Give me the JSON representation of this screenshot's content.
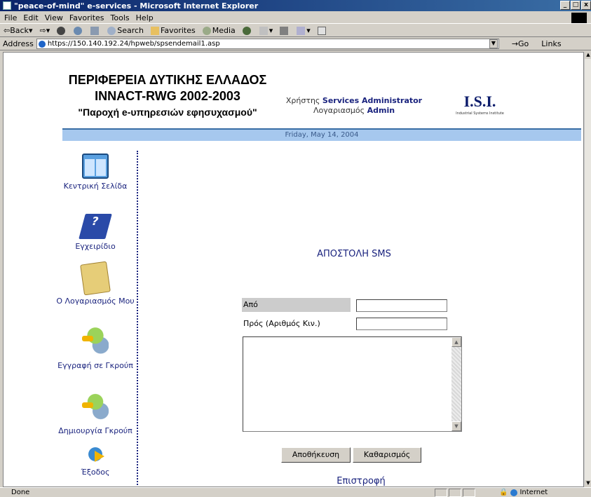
{
  "window": {
    "title": "\"peace-of-mind\" e-services - Microsoft Internet Explorer"
  },
  "menu": [
    "File",
    "Edit",
    "View",
    "Favorites",
    "Tools",
    "Help"
  ],
  "toolbar": {
    "back": "Back",
    "search": "Search",
    "favorites": "Favorites",
    "media": "Media"
  },
  "address": {
    "label": "Address",
    "url": "https://150.140.192.24/hpweb/spsendemail1.asp",
    "go": "Go",
    "links": "Links"
  },
  "header": {
    "line1": "ΠΕΡΙΦΕΡΕΙΑ ΔΥΤΙΚΗΣ ΕΛΛΑΔΟΣ",
    "line2": "INNACT-RWG 2002-2003",
    "line3": "\"Παροχή e-υπηρεσιών εφησυχασμού\"",
    "user_label": "Χρήστης",
    "user_name": "Services Administrator",
    "account_label": "Λογαριασμός",
    "account_name": "Admin",
    "logo_text": "I.S.I.",
    "logo_sub": "Industrial Systems Institute",
    "date": "Friday, May 14, 2004"
  },
  "sidebar": {
    "items": [
      {
        "label": "Κεντρική Σελίδα",
        "icon": "home-icon"
      },
      {
        "label": "Εγχειρίδιο",
        "icon": "manual-icon"
      },
      {
        "label": "Ο Λογαριασμός Μου",
        "icon": "account-icon"
      },
      {
        "label": "Εγγραφή σε Γκρούπ",
        "icon": "join-group-icon"
      },
      {
        "label": "Δημιουργία Γκρούπ",
        "icon": "create-group-icon"
      },
      {
        "label": "Έξοδος",
        "icon": "exit-icon"
      }
    ]
  },
  "form": {
    "title": "ΑΠΟΣΤΟΛΗ SMS",
    "from_label": "Από",
    "from_value": "",
    "to_label": "Πρός (Αριθμός Κιν.)",
    "to_value": "",
    "message_value": "",
    "save_label": "Αποθήκευση",
    "clear_label": "Καθαρισμός",
    "return_label": "Επιστροφή"
  },
  "status": {
    "text": "Done",
    "zone": "Internet"
  }
}
